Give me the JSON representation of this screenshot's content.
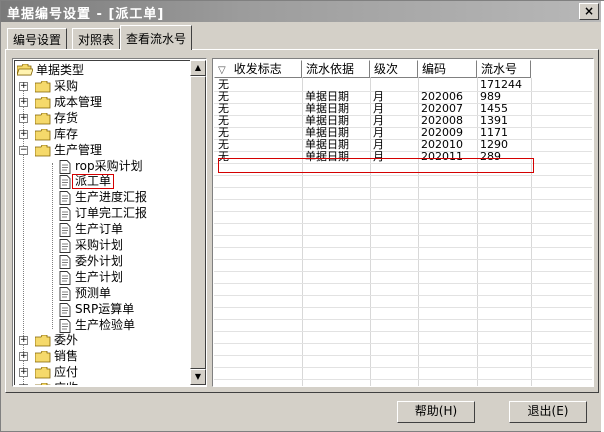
{
  "window": {
    "title": "单据编号设置 - [派工单]",
    "close_glyph": "×"
  },
  "tabs": [
    {
      "label": "编号设置"
    },
    {
      "label": "对照表"
    },
    {
      "label": "查看流水号",
      "active": true
    }
  ],
  "tree": {
    "root": "单据类型",
    "nodes": [
      {
        "label": "采购",
        "expander": "+"
      },
      {
        "label": "成本管理",
        "expander": "+"
      },
      {
        "label": "存货",
        "expander": "+"
      },
      {
        "label": "库存",
        "expander": "+"
      },
      {
        "label": "生产管理",
        "expander": "−"
      },
      {
        "label": "rop采购计划"
      },
      {
        "label": "派工单",
        "selected": true
      },
      {
        "label": "生产进度汇报"
      },
      {
        "label": "订单完工汇报"
      },
      {
        "label": "生产订单"
      },
      {
        "label": "采购计划"
      },
      {
        "label": "委外计划"
      },
      {
        "label": "生产计划"
      },
      {
        "label": "预测单"
      },
      {
        "label": "SRP运算单"
      },
      {
        "label": "生产检验单"
      },
      {
        "label": "委外",
        "expander": "+"
      },
      {
        "label": "销售",
        "expander": "+"
      },
      {
        "label": "应付",
        "expander": "+"
      },
      {
        "label": "应收",
        "expander": "+"
      }
    ]
  },
  "grid": {
    "sort_glyph": "▽",
    "columns": [
      "收发标志",
      "流水依据",
      "级次",
      "编码",
      "流水号"
    ],
    "rows": [
      [
        "无",
        "",
        "",
        "",
        "171244"
      ],
      [
        "无",
        "单据日期",
        "月",
        "202006",
        "989"
      ],
      [
        "无",
        "单据日期",
        "月",
        "202007",
        "1455"
      ],
      [
        "无",
        "单据日期",
        "月",
        "202008",
        "1391"
      ],
      [
        "无",
        "单据日期",
        "月",
        "202009",
        "1171"
      ],
      [
        "无",
        "单据日期",
        "月",
        "202010",
        "1290"
      ],
      [
        "无",
        "单据日期",
        "月",
        "202011",
        "289"
      ]
    ]
  },
  "buttons": {
    "help": "帮助(H)",
    "exit": "退出(E)"
  },
  "colors": {
    "highlight_border": "#d40000",
    "folder": "#f5d96b"
  }
}
